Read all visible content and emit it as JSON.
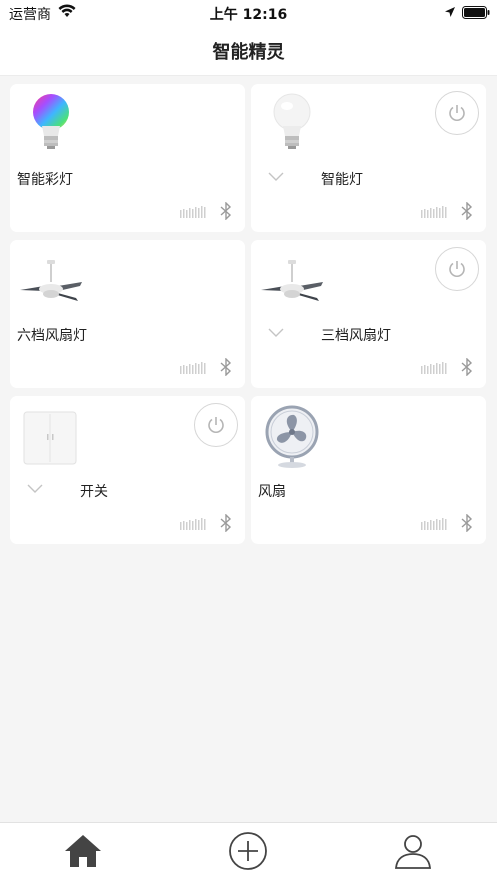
{
  "status_bar": {
    "carrier": "运营商",
    "time": "上午 12:16"
  },
  "nav": {
    "title": "智能精灵"
  },
  "devices": [
    {
      "name": "智能彩灯",
      "image": "color-bulb-image",
      "has_power": false,
      "has_chevron": false
    },
    {
      "name": "智能灯",
      "image": "white-bulb-image",
      "has_power": true,
      "has_chevron": true
    },
    {
      "name": "六档风扇灯",
      "image": "ceiling-fan-image",
      "has_power": false,
      "has_chevron": false
    },
    {
      "name": "三档风扇灯",
      "image": "ceiling-fan-image",
      "has_power": true,
      "has_chevron": true
    },
    {
      "name": "开关",
      "image": "wall-switch-image",
      "has_power": true,
      "has_chevron": true
    },
    {
      "name": "风扇",
      "image": "desk-fan-image",
      "has_power": false,
      "has_chevron": false
    }
  ],
  "tab_bar": {
    "items": [
      "home-icon",
      "add-circle-icon",
      "user-icon"
    ],
    "active": "home-icon"
  },
  "colors": {
    "background": "#f5f5f5",
    "card": "#ffffff",
    "icon_gray": "#b5b5b5",
    "tab_active": "#444444"
  }
}
